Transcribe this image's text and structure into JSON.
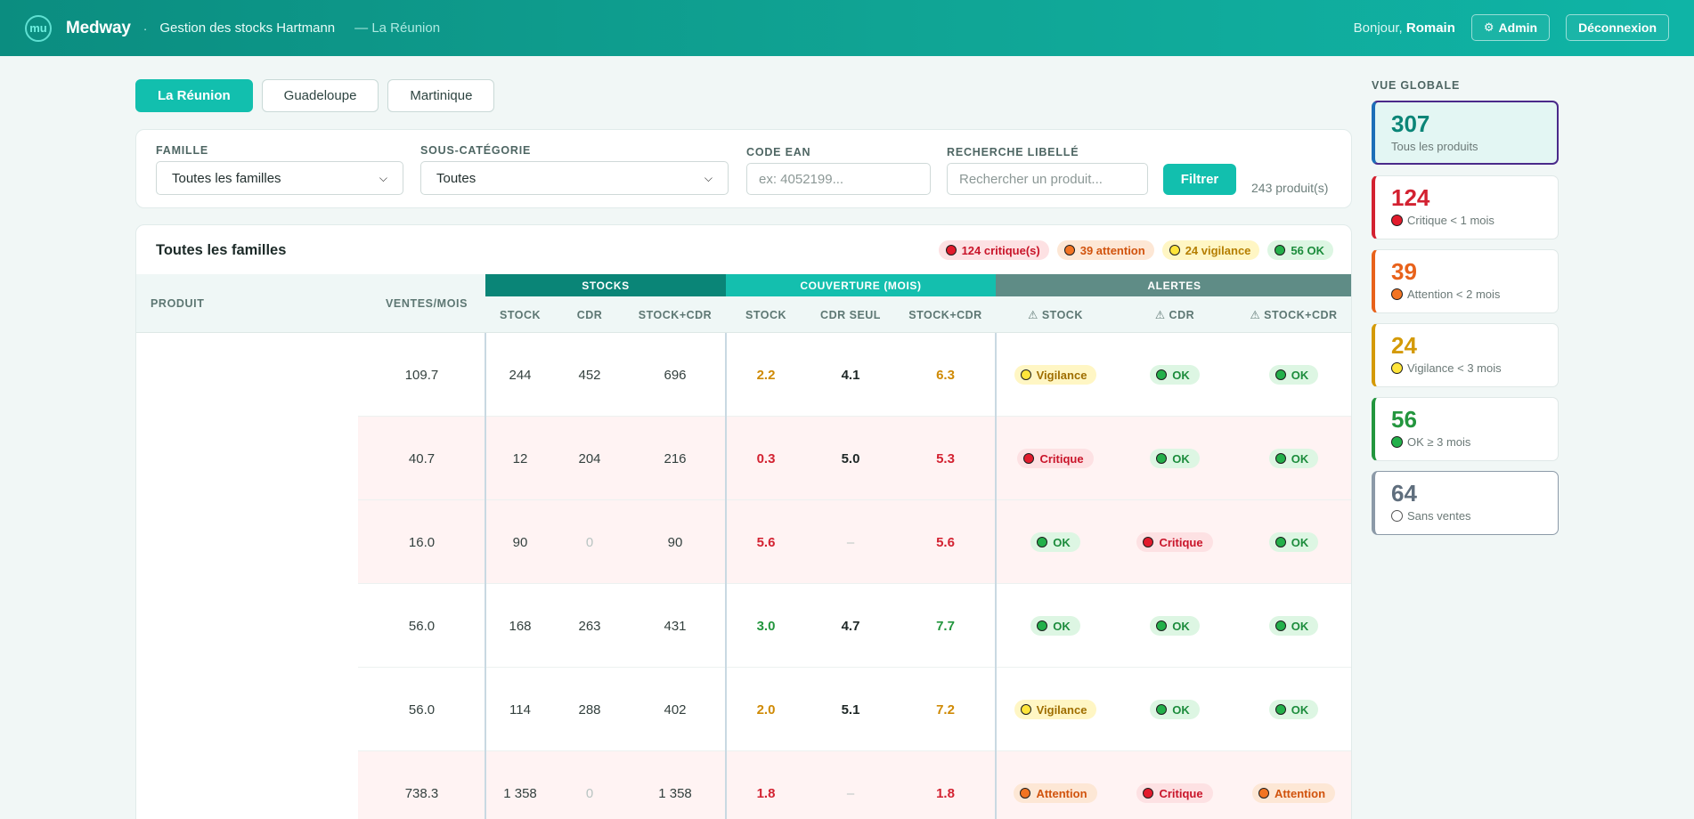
{
  "header": {
    "logo_glyph": "mu",
    "brand": "Medway",
    "separator": "·",
    "subtitle": "Gestion des stocks Hartmann",
    "region": "— La Réunion",
    "greeting_prefix": "Bonjour,",
    "user_name": "Romain",
    "admin_label": "Admin",
    "logout_label": "Déconnexion"
  },
  "region_tabs": [
    {
      "label": "La Réunion",
      "active": true
    },
    {
      "label": "Guadeloupe",
      "active": false
    },
    {
      "label": "Martinique",
      "active": false
    }
  ],
  "filters": {
    "famille_label": "FAMILLE",
    "famille_value": "Toutes les familles",
    "souscat_label": "SOUS-CATÉGORIE",
    "souscat_value": "Toutes",
    "ean_label": "CODE EAN",
    "ean_placeholder": "ex: 4052199...",
    "search_label": "RECHERCHE LIBELLÉ",
    "search_placeholder": "Rechercher un produit...",
    "submit_label": "Filtrer",
    "count_text": "243 produit(s)"
  },
  "table": {
    "title": "Toutes les familles",
    "summary": {
      "critique": "124 critique(s)",
      "attention": "39 attention",
      "vigilance": "24 vigilance",
      "ok": "56 OK"
    },
    "headers": {
      "produit": "PRODUIT",
      "ventes": "VENTES/MOIS",
      "group_stocks": "STOCKS",
      "group_couverture": "COUVERTURE (MOIS)",
      "group_alertes": "ALERTES",
      "stock": "STOCK",
      "cdr": "CDR",
      "stock_cdr": "STOCK+CDR",
      "cov_stock": "STOCK",
      "cov_cdr": "CDR SEUL",
      "cov_stock_cdr": "STOCK+CDR",
      "al_stock": "⚠ STOCK",
      "al_cdr": "⚠ CDR",
      "al_stock_cdr": "⚠ STOCK+CDR"
    },
    "rows": [
      {
        "ventes": "109.7",
        "stock": "244",
        "cdr": "452",
        "stock_cdr": "696",
        "cov_stock": "2.2",
        "cov_cdr": "4.1",
        "cov_total": "6.3",
        "a_stock": "Vigilance",
        "a_cdr": "OK",
        "a_total": "OK"
      },
      {
        "ventes": "40.7",
        "stock": "12",
        "cdr": "204",
        "stock_cdr": "216",
        "cov_stock": "0.3",
        "cov_cdr": "5.0",
        "cov_total": "5.3",
        "a_stock": "Critique",
        "a_cdr": "OK",
        "a_total": "OK"
      },
      {
        "ventes": "16.0",
        "stock": "90",
        "cdr": "0",
        "stock_cdr": "90",
        "cov_stock": "5.6",
        "cov_cdr": "–",
        "cov_total": "5.6",
        "a_stock": "OK",
        "a_cdr": "Critique",
        "a_total": "OK"
      },
      {
        "ventes": "56.0",
        "stock": "168",
        "cdr": "263",
        "stock_cdr": "431",
        "cov_stock": "3.0",
        "cov_cdr": "4.7",
        "cov_total": "7.7",
        "a_stock": "OK",
        "a_cdr": "OK",
        "a_total": "OK"
      },
      {
        "ventes": "56.0",
        "stock": "114",
        "cdr": "288",
        "stock_cdr": "402",
        "cov_stock": "2.0",
        "cov_cdr": "5.1",
        "cov_total": "7.2",
        "a_stock": "Vigilance",
        "a_cdr": "OK",
        "a_total": "OK"
      },
      {
        "ventes": "738.3",
        "stock": "1 358",
        "cdr": "0",
        "stock_cdr": "1 358",
        "cov_stock": "1.8",
        "cov_cdr": "–",
        "cov_total": "1.8",
        "a_stock": "Attention",
        "a_cdr": "Critique",
        "a_total": "Attention"
      }
    ]
  },
  "sidebar": {
    "title": "VUE GLOBALE",
    "cards": [
      {
        "value": "307",
        "label": "Tous les produits",
        "color": "#0a8577"
      },
      {
        "value": "124",
        "label": "Critique < 1 mois",
        "color": "#d32231"
      },
      {
        "value": "39",
        "label": "Attention < 2 mois",
        "color": "#e8621b"
      },
      {
        "value": "24",
        "label": "Vigilance < 3 mois",
        "color": "#d49a07"
      },
      {
        "value": "56",
        "label": "OK ≥ 3 mois",
        "color": "#23963e"
      },
      {
        "value": "64",
        "label": "Sans ventes",
        "color": "#5f6e7d"
      }
    ]
  },
  "colors": {
    "primary": "#12bfae",
    "header_dark": "#0b8d80",
    "critique": "#e21b2c",
    "attention": "#f27423",
    "vigilance": "#ffe53b",
    "ok": "#23b04a"
  }
}
